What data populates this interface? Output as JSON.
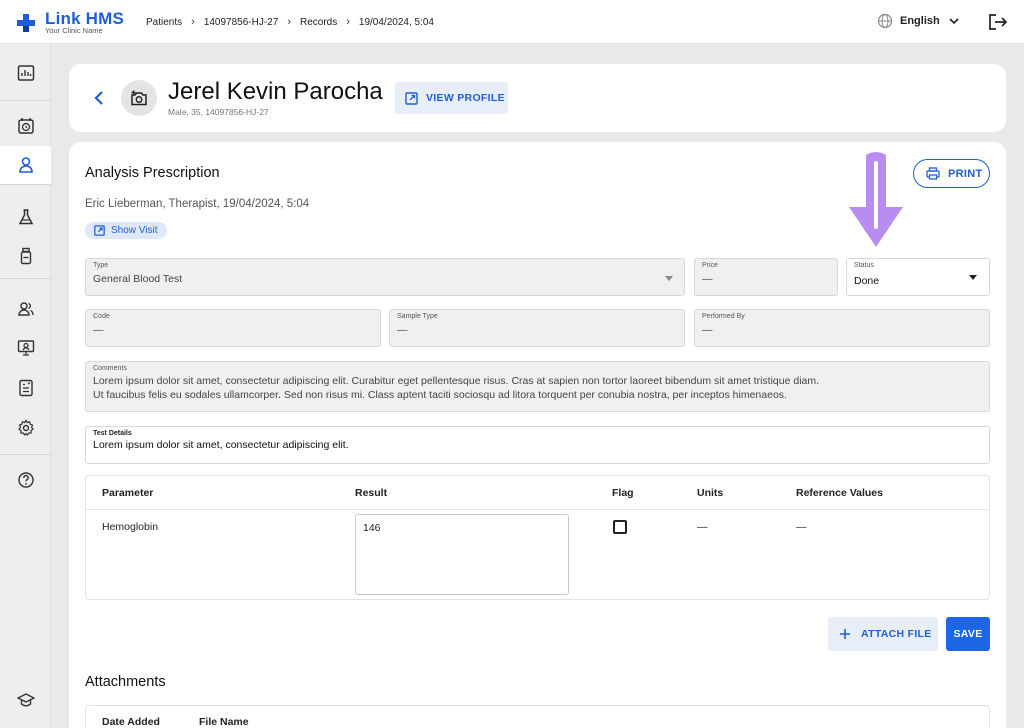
{
  "brand": {
    "name": "Link HMS",
    "subtitle": "Your Clinic Name",
    "color": "#1e5fd6"
  },
  "breadcrumb": [
    "Patients",
    "14097856-HJ-27",
    "Records",
    "19/04/2024, 5:04"
  ],
  "language": {
    "label": "English",
    "icon": "globe-icon"
  },
  "sidebar": {
    "items": [
      {
        "name": "reports",
        "icon": "chart-icon"
      },
      {
        "name": "appointments",
        "icon": "calendar-clock-icon"
      },
      {
        "name": "patients",
        "icon": "person-icon",
        "active": true
      },
      {
        "name": "laboratory",
        "icon": "flask-icon"
      },
      {
        "name": "pharmacy",
        "icon": "bottle-icon"
      },
      {
        "name": "staff",
        "icon": "users-icon"
      },
      {
        "name": "telemedicine",
        "icon": "monitor-icon"
      },
      {
        "name": "billing",
        "icon": "document-icon"
      },
      {
        "name": "settings",
        "icon": "gear-icon"
      },
      {
        "name": "help",
        "icon": "help-icon"
      },
      {
        "name": "training",
        "icon": "graduation-cap-icon"
      }
    ]
  },
  "patient": {
    "name": "Jerel Kevin Parocha",
    "meta": "Male, 35, 14097856-HJ-27",
    "view_profile_label": "VIEW PROFILE"
  },
  "prescription": {
    "title": "Analysis Prescription",
    "meta": "Eric Lieberman, Therapist, 19/04/2024, 5:04",
    "show_visit_label": "Show Visit",
    "print_label": "PRINT"
  },
  "form": {
    "type": {
      "label": "Type",
      "value": "General Blood Test"
    },
    "price": {
      "label": "Price",
      "value": "—"
    },
    "status": {
      "label": "Status",
      "value": "Done"
    },
    "code": {
      "label": "Code",
      "value": "—"
    },
    "sample_type": {
      "label": "Sample Type",
      "value": "—"
    },
    "performed_by": {
      "label": "Performed By",
      "value": "—"
    },
    "comments": {
      "label": "Comments",
      "line1": "Lorem ipsum dolor sit amet, consectetur adipiscing elit. Curabitur eget pellentesque risus. Cras at sapien non tortor laoreet bibendum sit amet tristique diam.",
      "line2": "Ut faucibus felis eu sodales ullamcorper. Sed non risus mi. Class aptent taciti sociosqu ad litora torquent per conubia nostra, per inceptos himenaeos."
    },
    "test_details": {
      "label": "Test Details",
      "value": "Lorem ipsum dolor sit amet, consectetur adipiscing elit."
    }
  },
  "results": {
    "headers": [
      "Parameter",
      "Result",
      "Flag",
      "Units",
      "Reference Values"
    ],
    "rows": [
      {
        "parameter": "Hemoglobin",
        "result": "146",
        "flag": false,
        "units": "—",
        "reference": "—"
      }
    ]
  },
  "actions": {
    "attach_label": "ATTACH FILE",
    "save_label": "SAVE"
  },
  "attachments": {
    "title": "Attachments",
    "headers": [
      "Date Added",
      "File Name"
    ]
  },
  "annotation": {
    "arrow_color": "#b98cf2"
  }
}
